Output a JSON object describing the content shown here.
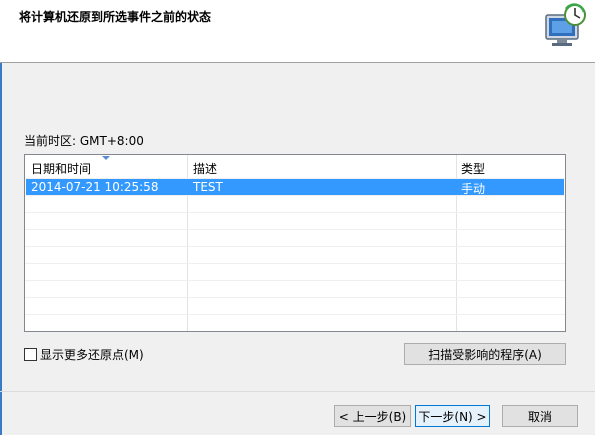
{
  "header": {
    "title": "将计算机还原到所选事件之前的状态",
    "icon": "system-restore-monitor-icon"
  },
  "timezone_label": "当前时区: GMT+8:00",
  "list": {
    "columns": [
      "日期和时间",
      "描述",
      "类型"
    ],
    "rows": [
      {
        "datetime": "2014-07-21 10:25:58",
        "description": "TEST",
        "type": "手动"
      }
    ]
  },
  "show_more_label": "显示更多还原点(M)",
  "scan_button": "扫描受影响的程序(A)",
  "buttons": {
    "back": "< 上一步(B)",
    "next": "下一步(N) >",
    "cancel": "取消"
  },
  "colors": {
    "selection": "#3399ff",
    "accent": "#0078d7"
  }
}
